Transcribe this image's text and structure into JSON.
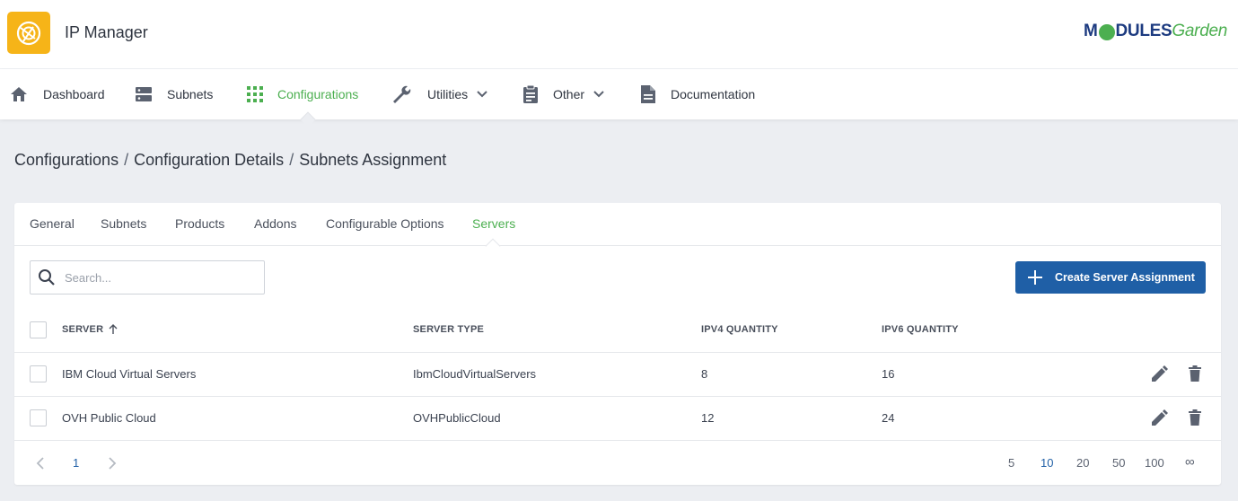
{
  "app": {
    "title": "IP Manager",
    "brand_left": "M",
    "brand_mid": "DULES",
    "brand_right": "Garden"
  },
  "nav": {
    "items": [
      {
        "label": "Dashboard",
        "icon": "home-icon"
      },
      {
        "label": "Subnets",
        "icon": "server-icon"
      },
      {
        "label": "Configurations",
        "icon": "grid-icon",
        "active": true
      },
      {
        "label": "Utilities",
        "icon": "wrench-icon",
        "dropdown": true
      },
      {
        "label": "Other",
        "icon": "clipboard-icon",
        "dropdown": true
      },
      {
        "label": "Documentation",
        "icon": "document-icon"
      }
    ]
  },
  "breadcrumb": [
    "Configurations",
    "Configuration Details",
    "Subnets Assignment"
  ],
  "tabs": [
    "General",
    "Subnets",
    "Products",
    "Addons",
    "Configurable Options",
    "Servers"
  ],
  "active_tab": "Servers",
  "search": {
    "placeholder": "Search..."
  },
  "create_button": "Create Server Assignment",
  "table": {
    "columns": [
      "SERVER",
      "SERVER TYPE",
      "IPV4 QUANTITY",
      "IPV6 QUANTITY"
    ],
    "sort_column": "SERVER",
    "rows": [
      {
        "server": "IBM Cloud Virtual Servers",
        "type": "IbmCloudVirtualServers",
        "ipv4": "8",
        "ipv6": "16"
      },
      {
        "server": "OVH Public Cloud",
        "type": "OVHPublicCloud",
        "ipv4": "12",
        "ipv6": "24"
      }
    ]
  },
  "pagination": {
    "current_page": "1",
    "page_sizes": [
      "5",
      "10",
      "20",
      "50",
      "100",
      "∞"
    ],
    "selected_page_size": "10"
  },
  "colors": {
    "accent_green": "#4caf50",
    "primary_blue": "#1f5fa6",
    "logo_yellow": "#f6b418"
  }
}
